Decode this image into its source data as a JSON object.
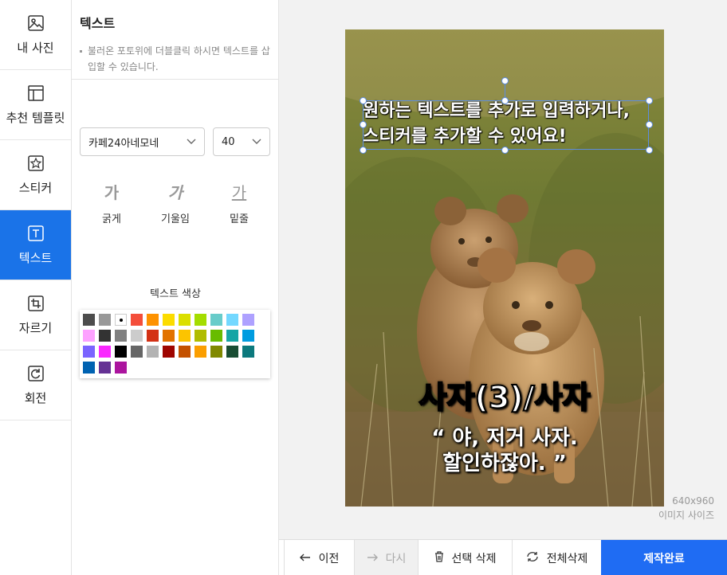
{
  "nav": {
    "items": [
      {
        "label": "내 사진",
        "icon": "image-icon"
      },
      {
        "label": "추천 템플릿",
        "icon": "template-icon"
      },
      {
        "label": "스티커",
        "icon": "star-icon"
      },
      {
        "label": "텍스트",
        "icon": "text-icon",
        "active": true
      },
      {
        "label": "자르기",
        "icon": "crop-icon"
      },
      {
        "label": "회전",
        "icon": "rotate-icon"
      }
    ]
  },
  "panel": {
    "title": "텍스트",
    "hint": "불러온 포토위에 더블클릭 하시면 텍스트를 삽입할 수 있습니다.",
    "font_value": "카페24아네모네",
    "size_value": "40",
    "styles": [
      {
        "glyph": "가",
        "label": "굵게"
      },
      {
        "glyph": "가",
        "label": "기울임"
      },
      {
        "glyph": "가",
        "label": "밑줄"
      }
    ],
    "color_label": "텍스트 색상",
    "palette": [
      "#4d4d4d",
      "#999999",
      "#ffffff",
      "#f44e3b",
      "#fe9200",
      "#fcdc00",
      "#dbdf00",
      "#a4dd00",
      "#68ccca",
      "#73d8ff",
      "#aea1ff",
      "#fda1ff",
      "#333333",
      "#808080",
      "#cccccc",
      "#d33115",
      "#e27300",
      "#fcc400",
      "#b0bc00",
      "#68bc00",
      "#16a5a5",
      "#009ce0",
      "#7b64ff",
      "#fa28ff",
      "#000000",
      "#666666",
      "#b3b3b3",
      "#9f0500",
      "#c45100",
      "#fb9e00",
      "#808900",
      "#194d33",
      "#0c797d",
      "#0062b1",
      "#653294",
      "#ab149e"
    ]
  },
  "canvas": {
    "text_top_line1": "원하는 텍스트를 추가로 입력하거나,",
    "text_top_line2": "스티커를 추가할 수 있어요!",
    "caption_big": "사자(3)/사자",
    "caption_quote_line1": "“ 야, 저거 사자.",
    "caption_quote_line2": "할인하잖아. ”",
    "image_size": "640x960",
    "image_size_label": "이미지 사이즈"
  },
  "toolbar": {
    "prev": "이전",
    "redo": "다시",
    "delete_selected": "선택 삭제",
    "delete_all": "전체삭제",
    "done": "제작완료"
  },
  "colors": {
    "accent": "#1f6cf3",
    "nav_active": "#1a73e8",
    "selection": "#5d8de0"
  }
}
